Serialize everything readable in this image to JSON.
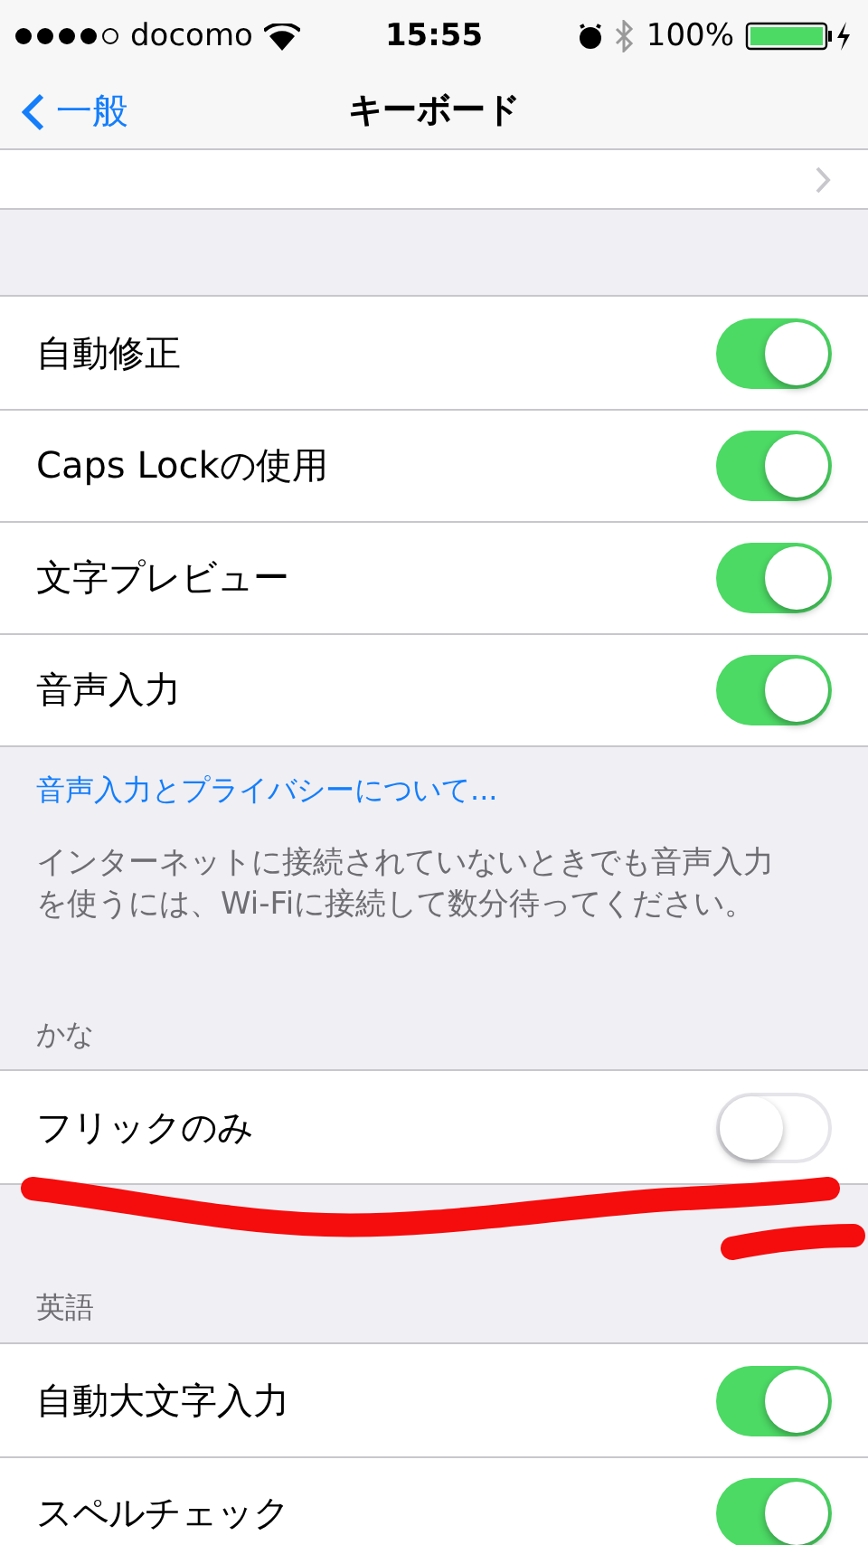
{
  "status_bar": {
    "carrier": "docomo",
    "time": "15:55",
    "battery": "100%"
  },
  "nav_bar": {
    "back": "一般",
    "title": "キーボード"
  },
  "groups": [
    {
      "rows": [
        {
          "label": "自動修正",
          "on": true
        },
        {
          "label": "Caps Lockの使用",
          "on": true
        },
        {
          "label": "文字プレビュー",
          "on": true
        },
        {
          "label": "音声入力",
          "on": true
        }
      ],
      "link": "音声入力とプライバシーについて...",
      "footer": "インターネットに接続されていないときでも音声入力を使うには、Wi-Fiに接続して数分待ってください。"
    },
    {
      "header": "かな",
      "rows": [
        {
          "label": "フリックのみ",
          "on": false
        }
      ]
    },
    {
      "header": "英語",
      "rows": [
        {
          "label": "自動大文字入力",
          "on": true
        },
        {
          "label": "スペルチェック",
          "on": true
        }
      ]
    }
  ]
}
